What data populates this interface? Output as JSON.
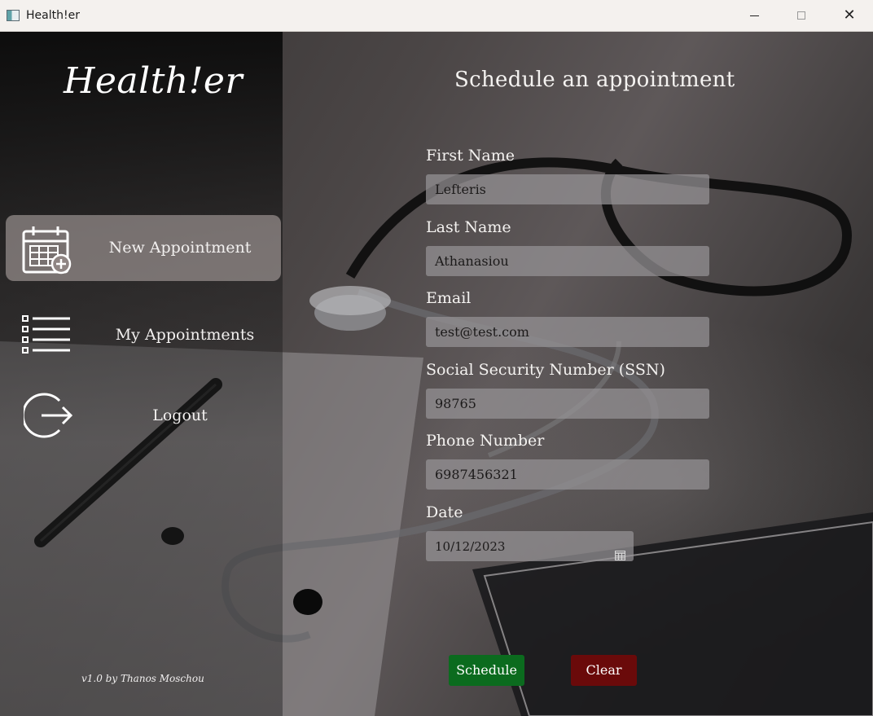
{
  "window": {
    "title": "Health!er"
  },
  "sidebar": {
    "logo": "Health!er",
    "items": [
      {
        "label": "New Appointment",
        "icon": "calendar-add-icon",
        "active": true
      },
      {
        "label": "My Appointments",
        "icon": "list-icon",
        "active": false
      },
      {
        "label": "Logout",
        "icon": "logout-icon",
        "active": false
      }
    ],
    "footer": "v1.0 by Thanos Moschou"
  },
  "form": {
    "title": "Schedule an appointment",
    "fields": [
      {
        "label": "First Name",
        "value": "Lefteris"
      },
      {
        "label": "Last Name",
        "value": "Athanasiou"
      },
      {
        "label": "Email",
        "value": "test@test.com"
      },
      {
        "label": "Social Security Number (SSN)",
        "value": "98765"
      },
      {
        "label": "Phone Number",
        "value": "6987456321"
      },
      {
        "label": "Date",
        "value": "10/12/2023"
      }
    ],
    "buttons": {
      "schedule": "Schedule",
      "clear": "Clear"
    }
  },
  "colors": {
    "schedule_button": "#0b6b1e",
    "clear_button": "#6a0a0a",
    "active_nav": "#aaa09e"
  }
}
